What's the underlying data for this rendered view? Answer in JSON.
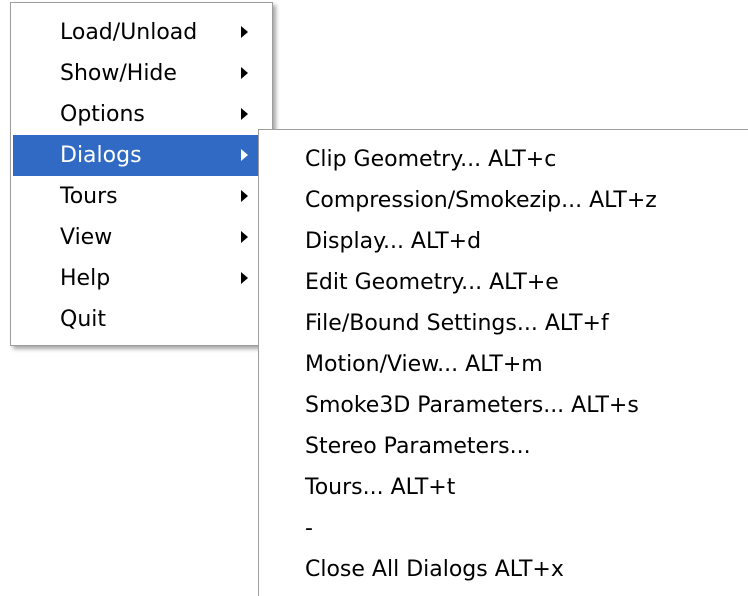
{
  "main_menu": {
    "items": [
      {
        "label": "Load/Unload",
        "has_submenu": true
      },
      {
        "label": "Show/Hide",
        "has_submenu": true
      },
      {
        "label": "Options",
        "has_submenu": true
      },
      {
        "label": "Dialogs",
        "has_submenu": true,
        "selected": true
      },
      {
        "label": "Tours",
        "has_submenu": true
      },
      {
        "label": "View",
        "has_submenu": true
      },
      {
        "label": "Help",
        "has_submenu": true
      },
      {
        "label": "Quit",
        "has_submenu": false
      }
    ]
  },
  "dialogs_submenu": {
    "items": [
      {
        "label": "Clip Geometry...  ALT+c"
      },
      {
        "label": "Compression/Smokezip...  ALT+z"
      },
      {
        "label": "Display...  ALT+d"
      },
      {
        "label": "Edit Geometry...  ALT+e"
      },
      {
        "label": "File/Bound Settings...  ALT+f"
      },
      {
        "label": "Motion/View...  ALT+m"
      },
      {
        "label": "Smoke3D Parameters...  ALT+s"
      },
      {
        "label": "Stereo Parameters..."
      },
      {
        "label": "Tours...  ALT+t"
      },
      {
        "label": "-"
      },
      {
        "label": "Close All Dialogs  ALT+x"
      }
    ]
  },
  "colors": {
    "selection_bg": "#316ac5",
    "selection_text": "#ffffff",
    "menu_bg": "#ffffff",
    "menu_border": "#9d9d9d"
  }
}
